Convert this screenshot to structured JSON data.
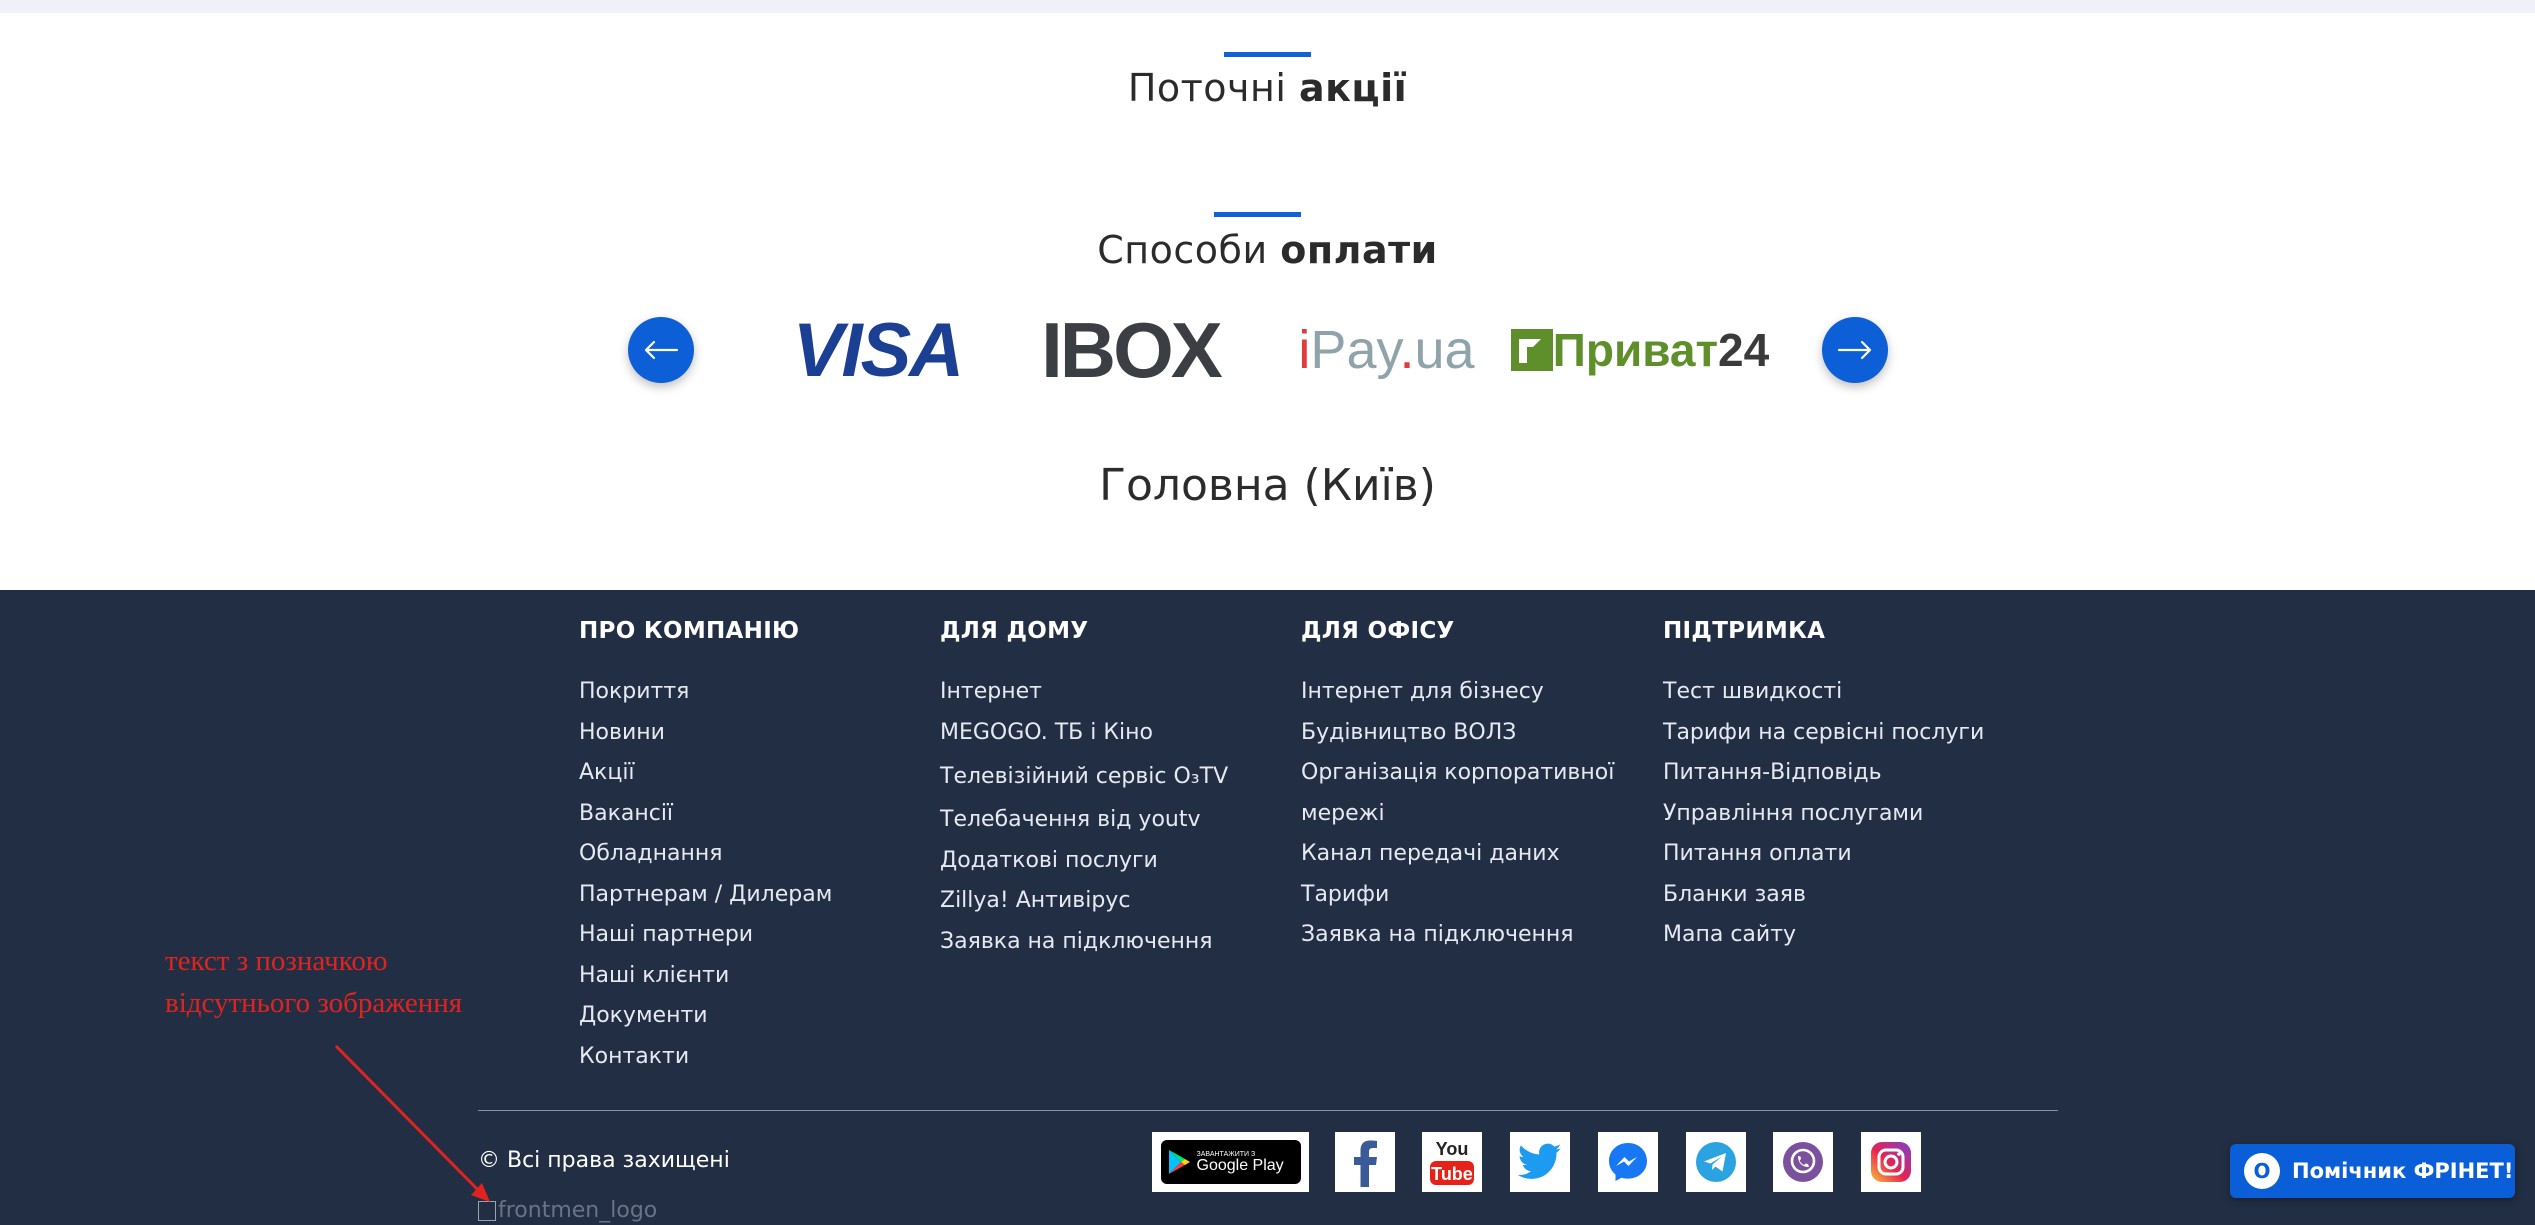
{
  "promotions": {
    "title_regular": "Поточні",
    "title_bold": "акції"
  },
  "payments": {
    "title_regular": "Способи",
    "title_bold": "оплати",
    "logos": {
      "visa": "VISA",
      "ibox": "IBOX",
      "ipay_i": "i",
      "ipay_rest": "Pay",
      "ipay_dot": ".",
      "ipay_tld": "ua",
      "privat_word": "Приват",
      "privat_num": "24"
    },
    "icons": [
      "arrow-left-icon",
      "arrow-right-icon"
    ]
  },
  "city_heading": "Головна (Київ)",
  "footer": {
    "columns": [
      {
        "heading": "ПРО КОМПАНІЮ",
        "items": [
          "Покриття",
          "Новини",
          "Акції",
          "Вакансії",
          "Обладнання",
          "Партнерам / Дилерам",
          "Наші партнери",
          "Наші клієнти",
          "Документи",
          "Контакти"
        ]
      },
      {
        "heading": "ДЛЯ ДОМУ",
        "items": [
          "Інтернет",
          "MEGOGO. ТБ і Кіно",
          "Телевізійний сервіс O₃TV",
          "Телебачення від youtv",
          "Додаткові послуги",
          "Zillya! Антивірус",
          "Заявка на підключення"
        ]
      },
      {
        "heading": "ДЛЯ ОФІСУ",
        "items": [
          "Інтернет для бізнесу",
          "Будівництво ВОЛЗ",
          "Організація корпоративної",
          "мережі",
          "Канал передачі даних",
          "Тарифи",
          "Заявка на підключення"
        ]
      },
      {
        "heading": "ПІДТРИМКА",
        "items": [
          "Тест швидкості",
          "Тарифи на сервісні послуги",
          "Питання-Відповідь",
          "Управління послугами",
          "Питання оплати",
          "Бланки заяв",
          "Мапа сайту"
        ]
      }
    ],
    "copyright": "© Всі права захищені",
    "broken_logo_alt": "frontmen_logo",
    "google_play": {
      "small": "ЗАВАНТАЖИТИ З",
      "big": "Google Play"
    },
    "social_icons": [
      "google-play-badge",
      "facebook-icon",
      "youtube-icon",
      "twitter-icon",
      "messenger-icon",
      "telegram-icon",
      "viber-icon",
      "instagram-icon"
    ],
    "colors": {
      "background": "#222e44",
      "accent": "#1062d6"
    }
  },
  "annotation": {
    "line1": "текст з позначкою",
    "line2": "відсутнього зображення"
  },
  "helper_widget": {
    "label": "Помічник ФРІНЕТ!",
    "badge": "O"
  }
}
